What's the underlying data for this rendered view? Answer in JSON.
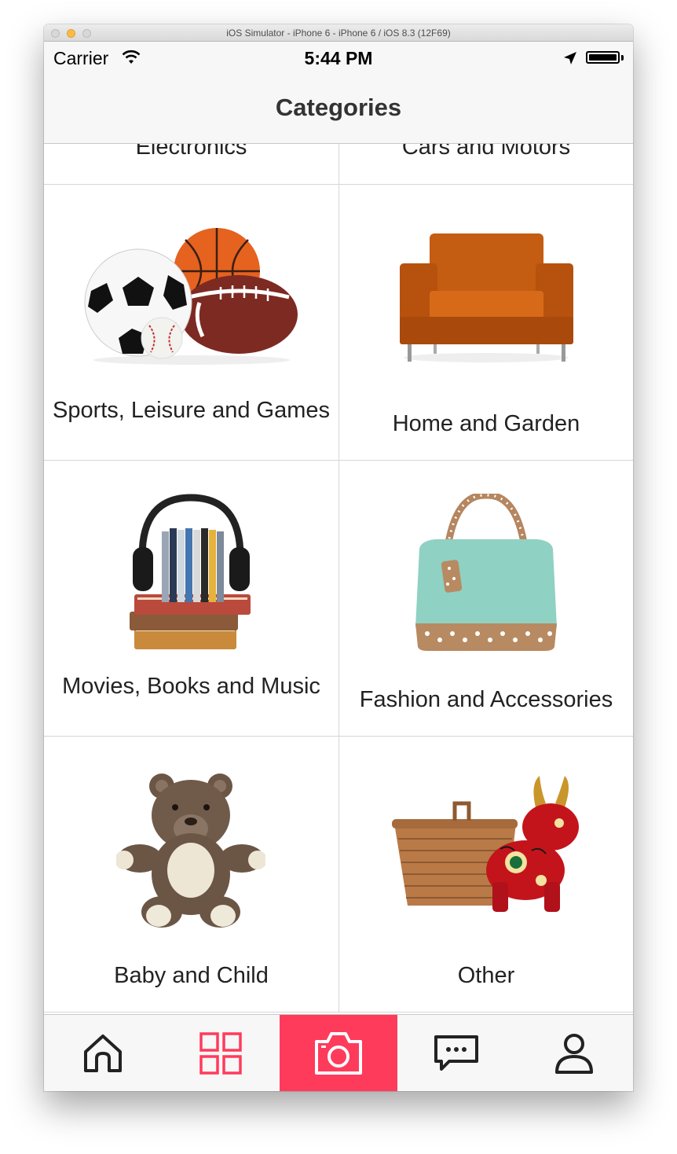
{
  "window": {
    "title": "iOS Simulator - iPhone 6 - iPhone 6 / iOS 8.3 (12F69)"
  },
  "status_bar": {
    "carrier": "Carrier",
    "time": "5:44 PM"
  },
  "nav": {
    "title": "Categories"
  },
  "categories": [
    {
      "label": "Electronics",
      "icon": "electronics-image"
    },
    {
      "label": "Cars and Motors",
      "icon": "cars-image"
    },
    {
      "label": "Sports, Leisure and Games",
      "icon": "sports-balls-image"
    },
    {
      "label": "Home and Garden",
      "icon": "armchair-image"
    },
    {
      "label": "Movies, Books and Music",
      "icon": "headphones-books-image"
    },
    {
      "label": "Fashion and Accessories",
      "icon": "handbag-image"
    },
    {
      "label": "Baby and Child",
      "icon": "teddy-bear-image"
    },
    {
      "label": "Other",
      "icon": "basket-figurine-image"
    }
  ],
  "tab_bar": {
    "items": [
      {
        "icon": "home-icon"
      },
      {
        "icon": "categories-grid-icon",
        "selected": true
      },
      {
        "icon": "camera-icon",
        "highlight": true
      },
      {
        "icon": "chat-icon"
      },
      {
        "icon": "profile-icon"
      }
    ],
    "accent": "#ff3b5c"
  }
}
